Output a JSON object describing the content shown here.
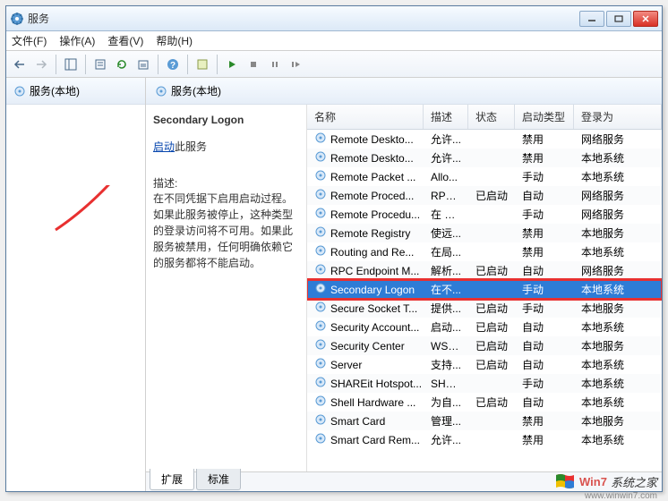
{
  "window": {
    "title": "服务"
  },
  "menu": {
    "file": "文件(F)",
    "action": "操作(A)",
    "view": "查看(V)",
    "help": "帮助(H)"
  },
  "left_pane": {
    "label": "服务(本地)"
  },
  "right_header": {
    "label": "服务(本地)"
  },
  "detail": {
    "service_name": "Secondary Logon",
    "action_link": "启动",
    "action_suffix": "此服务",
    "desc_label": "描述:",
    "desc_text": "在不同凭据下启用启动过程。如果此服务被停止，这种类型的登录访问将不可用。如果此服务被禁用，任何明确依赖它的服务都将不能启动。"
  },
  "columns": {
    "name": "名称",
    "desc": "描述",
    "status": "状态",
    "startup": "启动类型",
    "logon": "登录为"
  },
  "services": [
    {
      "name": "Remote Deskto...",
      "desc": "允许...",
      "status": "",
      "startup": "禁用",
      "logon": "网络服务"
    },
    {
      "name": "Remote Deskto...",
      "desc": "允许...",
      "status": "",
      "startup": "禁用",
      "logon": "本地系统"
    },
    {
      "name": "Remote Packet ...",
      "desc": "Allo...",
      "status": "",
      "startup": "手动",
      "logon": "本地系统"
    },
    {
      "name": "Remote Proced...",
      "desc": "RPC...",
      "status": "已启动",
      "startup": "自动",
      "logon": "网络服务"
    },
    {
      "name": "Remote Procedu...",
      "desc": "在 W...",
      "status": "",
      "startup": "手动",
      "logon": "网络服务"
    },
    {
      "name": "Remote Registry",
      "desc": "使远...",
      "status": "",
      "startup": "禁用",
      "logon": "本地服务"
    },
    {
      "name": "Routing and Re...",
      "desc": "在局...",
      "status": "",
      "startup": "禁用",
      "logon": "本地系统"
    },
    {
      "name": "RPC Endpoint M...",
      "desc": "解析...",
      "status": "已启动",
      "startup": "自动",
      "logon": "网络服务"
    },
    {
      "name": "Secondary Logon",
      "desc": "在不...",
      "status": "",
      "startup": "手动",
      "logon": "本地系统",
      "selected": true,
      "highlighted": true
    },
    {
      "name": "Secure Socket T...",
      "desc": "提供...",
      "status": "已启动",
      "startup": "手动",
      "logon": "本地服务"
    },
    {
      "name": "Security Account...",
      "desc": "启动...",
      "status": "已启动",
      "startup": "自动",
      "logon": "本地系统"
    },
    {
      "name": "Security Center",
      "desc": "WSC...",
      "status": "已启动",
      "startup": "自动",
      "logon": "本地服务"
    },
    {
      "name": "Server",
      "desc": "支持...",
      "status": "已启动",
      "startup": "自动",
      "logon": "本地系统"
    },
    {
      "name": "SHAREit Hotspot...",
      "desc": "SHA...",
      "status": "",
      "startup": "手动",
      "logon": "本地系统"
    },
    {
      "name": "Shell Hardware ...",
      "desc": "为自...",
      "status": "已启动",
      "startup": "自动",
      "logon": "本地系统"
    },
    {
      "name": "Smart Card",
      "desc": "管理...",
      "status": "",
      "startup": "禁用",
      "logon": "本地服务"
    },
    {
      "name": "Smart Card Rem...",
      "desc": "允许...",
      "status": "",
      "startup": "禁用",
      "logon": "本地系统"
    }
  ],
  "tabs": {
    "extended": "扩展",
    "standard": "标准"
  },
  "watermark": {
    "brand": "Win7",
    "text": "系统之家",
    "url": "www.winwin7.com"
  }
}
